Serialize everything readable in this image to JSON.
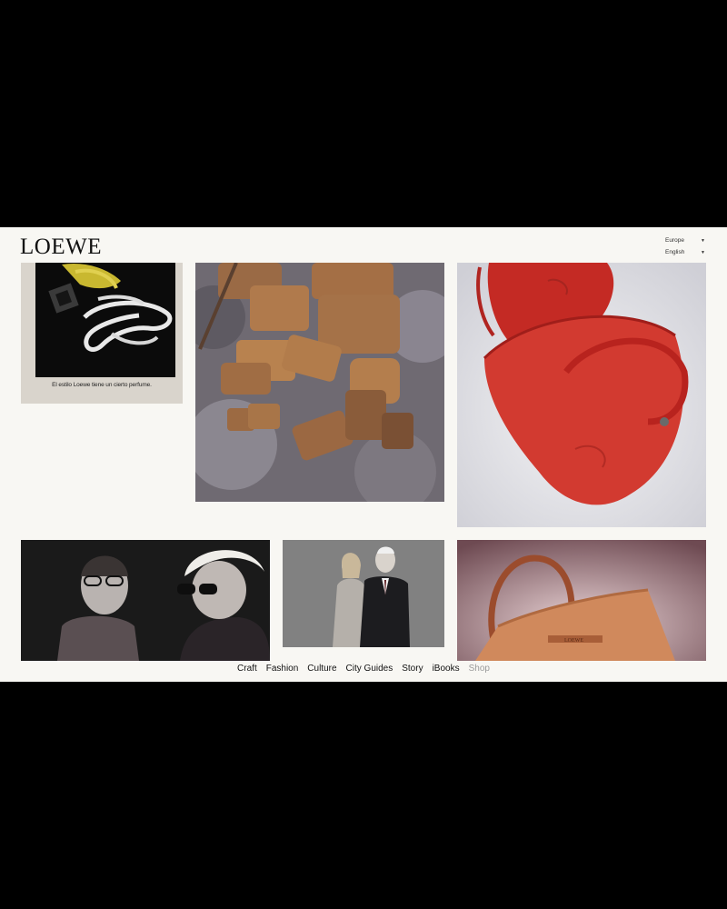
{
  "brand": {
    "logo": "LOEWE"
  },
  "selectors": {
    "region": "Europe",
    "language": "English"
  },
  "tiles": {
    "perfume_ad": {
      "caption": "El estilo Loewe tiene un cierto perfume."
    }
  },
  "nav": {
    "items": [
      "Craft",
      "Fashion",
      "Culture",
      "City Guides",
      "Story",
      "iBooks",
      "Shop"
    ]
  },
  "colors": {
    "page_bg": "#f8f7f3",
    "letterbox": "#000000",
    "nav_muted": "#9a9a9a"
  }
}
